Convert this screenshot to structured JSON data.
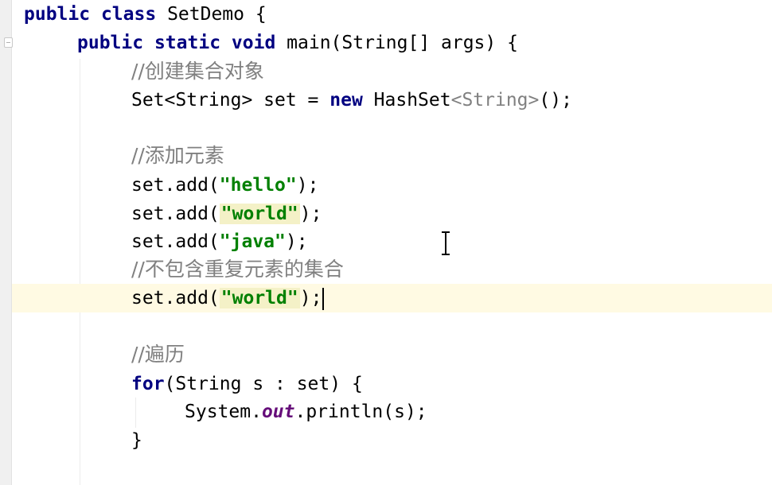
{
  "code": {
    "line1": {
      "kw1": "public",
      "kw2": "class",
      "name": "SetDemo {"
    },
    "line2": {
      "kw1": "public",
      "kw2": "static",
      "kw3": "void",
      "rest": "main(String[] args) {"
    },
    "line3": {
      "comment": "//创建集合对象"
    },
    "line4": {
      "a": "Set<String> set = ",
      "kw": "new",
      "b": "HashSet",
      "g": "<String>",
      "c": "();"
    },
    "line5": {
      "comment": "//添加元素"
    },
    "line6": {
      "pre": "set.add(",
      "str": "\"hello\"",
      "post": ");"
    },
    "line7": {
      "pre": "set.add(",
      "str": "\"world\"",
      "post": ");"
    },
    "line8": {
      "pre": "set.add(",
      "str": "\"java\"",
      "post": ");"
    },
    "line9": {
      "comment": "//不包含重复元素的集合"
    },
    "line10": {
      "pre": "set.add(",
      "str": "\"world\"",
      "post": ");"
    },
    "line11": {
      "comment": "//遍历"
    },
    "line12": {
      "kw": "for",
      "rest": "(String s : set) {"
    },
    "line13": {
      "pre": "System.",
      "field": "out",
      "post": ".println(s);"
    },
    "line14": {
      "text": "}"
    }
  },
  "colors": {
    "keyword": "#000080",
    "comment": "#808080",
    "string": "#008000",
    "field": "#660e7a",
    "current_line": "#fffae3",
    "string_highlight": "#f4f1c7"
  }
}
